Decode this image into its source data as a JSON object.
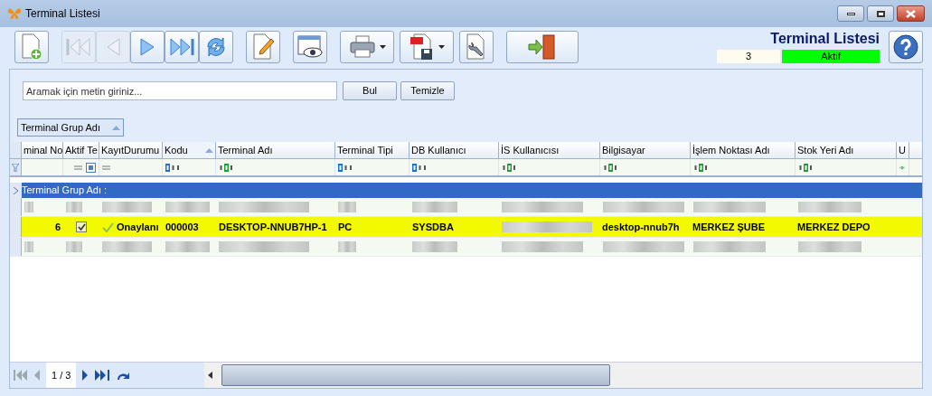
{
  "window": {
    "title": "Terminal Listesi"
  },
  "toolbar": [
    {
      "kind": "new",
      "disabled": false
    },
    {
      "kind": "first",
      "disabled": true
    },
    {
      "kind": "prev",
      "disabled": true
    },
    {
      "kind": "next",
      "disabled": false
    },
    {
      "kind": "last",
      "disabled": false
    },
    {
      "kind": "refresh",
      "disabled": false
    },
    {
      "kind": "edit",
      "disabled": false
    },
    {
      "kind": "view",
      "disabled": false
    },
    {
      "kind": "print",
      "disabled": false
    },
    {
      "kind": "pdf",
      "disabled": false
    },
    {
      "kind": "tools",
      "disabled": false
    },
    {
      "kind": "exit",
      "disabled": false
    }
  ],
  "header": {
    "title": "Terminal Listesi",
    "count": "3",
    "status": "Aktif"
  },
  "search": {
    "placeholder": "Aramak için metin giriniz...",
    "buttons": [
      "Bul",
      "Temizle"
    ]
  },
  "group_chip": "Terminal Grup Adı",
  "table": {
    "columns": [
      {
        "label": "minal No",
        "kind": "plain",
        "sorted": false
      },
      {
        "label": "Aktif Te",
        "kind": "check",
        "sorted": false
      },
      {
        "label": "KayıtDurumu",
        "kind": "status",
        "sorted": false
      },
      {
        "label": "Kodu",
        "kind": "text",
        "sorted": true
      },
      {
        "label": "Terminal Adı",
        "kind": "search",
        "sorted": false
      },
      {
        "label": "Terminal Tipi",
        "kind": "text",
        "sorted": false
      },
      {
        "label": "DB Kullanıcı",
        "kind": "text",
        "sorted": false
      },
      {
        "label": "İS Kullanıcısı",
        "kind": "search",
        "sorted": false
      },
      {
        "label": "Bilgisayar",
        "kind": "search",
        "sorted": false
      },
      {
        "label": "İşlem Noktası Adı",
        "kind": "search",
        "sorted": false
      },
      {
        "label": "Stok Yeri Adı",
        "kind": "search",
        "sorted": false
      },
      {
        "label": "U",
        "kind": "search",
        "sorted": false
      }
    ],
    "group_row": "Terminal Grup Adı :",
    "rows": [
      {
        "kind": "blurred",
        "selected": false
      },
      {
        "kind": "data",
        "selected": true,
        "no": "6",
        "active": true,
        "status": "Onaylanı",
        "code": "000003",
        "name": "DESKTOP-NNUB7HP-1",
        "type": "PC",
        "db_user": "SYSDBA",
        "computer": "desktop-nnub7h",
        "point": "MERKEZ ŞUBE",
        "stock": "MERKEZ DEPO"
      },
      {
        "kind": "blurred",
        "selected": false
      }
    ]
  },
  "pager": {
    "page": "1 / 3"
  }
}
